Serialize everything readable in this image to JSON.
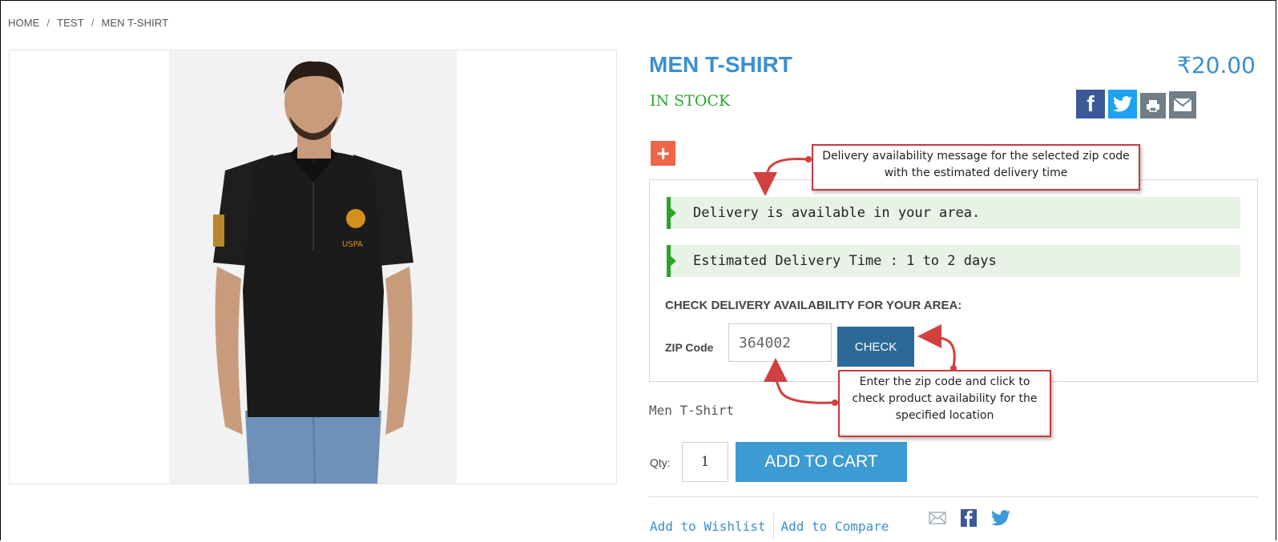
{
  "breadcrumb": [
    "HOME",
    "TEST",
    "MEN T-SHIRT"
  ],
  "breadcrumb_separator": "/",
  "product": {
    "title": "MEN T-SHIRT",
    "price": "₹20.00",
    "stock": "IN STOCK",
    "short_description": "Men T-Shirt",
    "image_label": "USPA"
  },
  "share_icons": [
    "facebook-icon",
    "twitter-icon",
    "print-icon",
    "email-icon"
  ],
  "expand_button": "+",
  "delivery": {
    "message_available": "Delivery is available in your area.",
    "message_time": "Estimated Delivery Time : 1 to 2 days",
    "heading": "CHECK DELIVERY AVAILABILITY FOR YOUR AREA:",
    "zip_label": "ZIP Code",
    "zip_value": "364002",
    "check_label": "CHECK"
  },
  "cart": {
    "qty_label": "Qty:",
    "qty_value": "1",
    "add_label": "ADD TO CART"
  },
  "links": {
    "wishlist": "Add to Wishlist",
    "compare": "Add to Compare"
  },
  "callouts": {
    "delivery_message": "Delivery availability message for the selected zip code with the estimated delivery time",
    "zip_instruction": "Enter the zip code and click to check product availability for the specified location"
  },
  "colors": {
    "accent": "#3b8fd0",
    "in_stock": "#2aa52a",
    "add_to_cart": "#3d9bd3",
    "check_button": "#2b6a98",
    "plus_button": "#f06447",
    "callout_border": "#c8393c"
  }
}
